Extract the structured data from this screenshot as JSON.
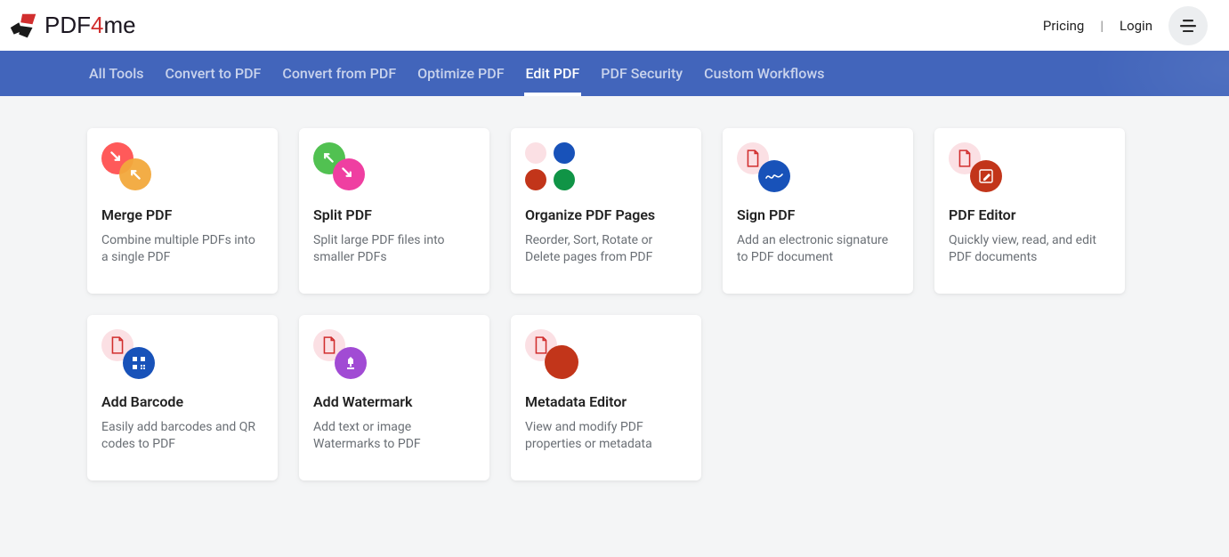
{
  "header": {
    "pricing": "Pricing",
    "login": "Login",
    "sep": "|"
  },
  "nav": {
    "items": [
      "All Tools",
      "Convert to PDF",
      "Convert from PDF",
      "Optimize PDF",
      "Edit PDF",
      "PDF Security",
      "Custom Workflows"
    ],
    "active_index": 4
  },
  "cards": [
    {
      "title": "Merge PDF",
      "desc": "Combine multiple PDFs into a single PDF"
    },
    {
      "title": "Split PDF",
      "desc": "Split large PDF files into smaller PDFs"
    },
    {
      "title": "Organize PDF Pages",
      "desc": "Reorder, Sort, Rotate or Delete pages from PDF"
    },
    {
      "title": "Sign PDF",
      "desc": "Add an electronic signature to PDF document"
    },
    {
      "title": "PDF Editor",
      "desc": "Quickly view, read, and edit PDF documents"
    },
    {
      "title": "Add Barcode",
      "desc": "Easily add barcodes and QR codes to PDF"
    },
    {
      "title": "Add Watermark",
      "desc": "Add text or image Watermarks to PDF"
    },
    {
      "title": "Metadata Editor",
      "desc": "View and modify PDF properties or metadata"
    }
  ]
}
